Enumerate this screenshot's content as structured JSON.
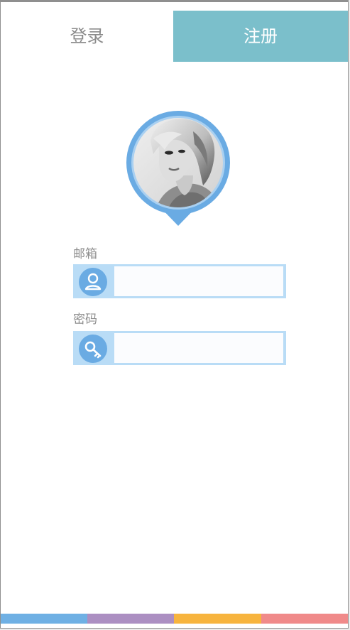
{
  "tabs": {
    "login": "登录",
    "register": "注册"
  },
  "form": {
    "email_label": "邮箱",
    "email_value": "",
    "password_label": "密码",
    "password_value": ""
  },
  "icons": {
    "email": "user-icon",
    "password": "key-icon"
  },
  "colors": {
    "active_tab": "#7bbfcb",
    "avatar_ring": "#6aabe3",
    "input_border": "#b9dcf6",
    "stripe_1": "#6fb0e4",
    "stripe_2": "#ac8fc2",
    "stripe_3": "#f7b43e",
    "stripe_4": "#f08a8a"
  }
}
